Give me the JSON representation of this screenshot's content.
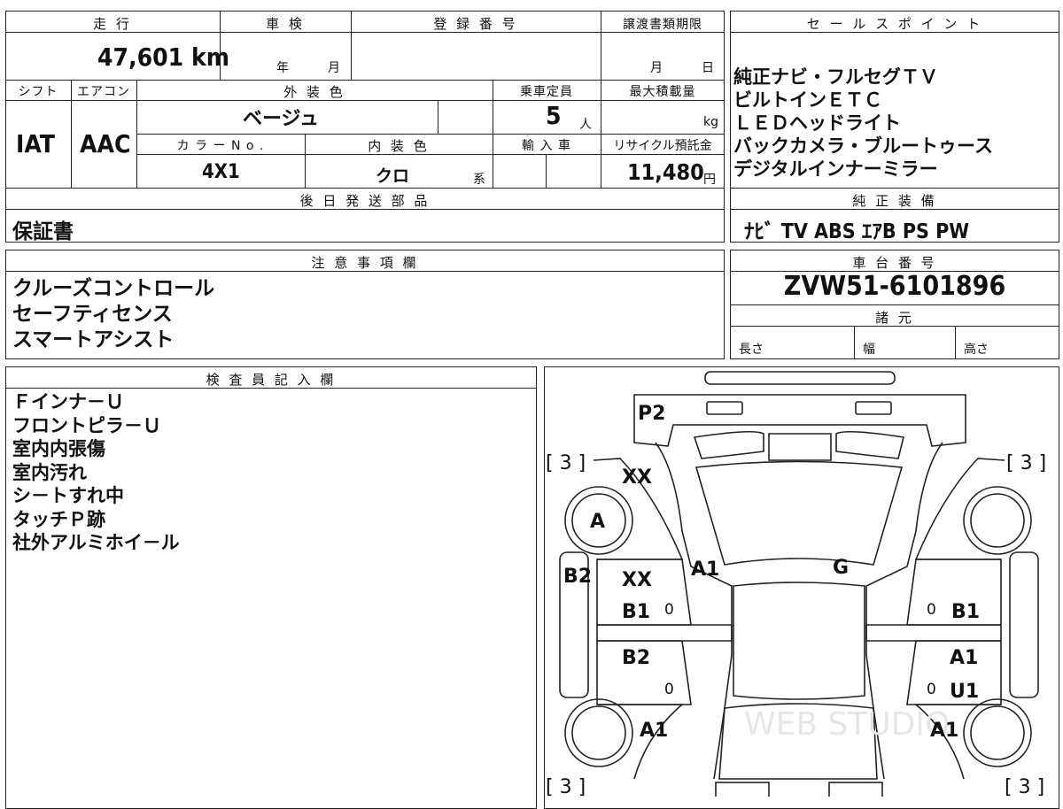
{
  "header": {
    "mileage_label": "走 行",
    "shaken_label": "車 検",
    "registration_label": "登 録 番 号",
    "transfer_deadline_label": "譲渡書類期限",
    "mileage_value": "47,601 km",
    "shaken_year": "年",
    "shaken_month": "月",
    "deadline_month": "月",
    "deadline_day": "日"
  },
  "row2": {
    "shift_label": "シフト",
    "aircon_label": "エアコン",
    "exterior_color_label": "外 装 色",
    "capacity_label": "乗車定員",
    "max_load_label": "最大積載量",
    "shift_value": "IAT",
    "aircon_value": "AAC",
    "exterior_color_value": "ベージュ",
    "capacity_value": "5",
    "capacity_unit": "人",
    "max_load_unit": "kg"
  },
  "row3": {
    "color_no_label": "カ ラ ー N o .",
    "interior_color_label": "内 装 色",
    "import_label": "輸 入 車",
    "recycle_label": "リサイクル預託金",
    "color_no_value": "4X1",
    "interior_color_value": "クロ",
    "interior_suffix": "系",
    "recycle_value": "11,480",
    "recycle_unit": "円"
  },
  "later_parts": {
    "label": "後 日 発 送 部 品",
    "value": "保証書"
  },
  "sales_points": {
    "label": "セ ー ル ス ポ イ ン ト",
    "items": [
      "純正ナビ・フルセグＴＶ",
      "ビルトインＥＴＣ",
      "ＬＥＤヘッドライト",
      "バックカメラ・ブルートゥース",
      "デジタルインナーミラー"
    ]
  },
  "genuine_equipment": {
    "label": "純 正 装 備",
    "value": "ﾅﾋﾞ TV ABS ｴｱB PS PW"
  },
  "notes": {
    "label": "注 意 事 項 欄",
    "items": [
      "クルーズコントロール",
      "セーフティセンス",
      "スマートアシスト"
    ]
  },
  "chassis": {
    "label": "車 台 番 号",
    "value": "ZVW51-6101896",
    "specs_label": "諸 元",
    "length_label": "長さ",
    "width_label": "幅",
    "height_label": "高さ"
  },
  "inspector": {
    "label": "検 査 員 記 入 欄",
    "items": [
      "Ｆインナ－Ｕ",
      "フロントピラ－Ｕ",
      "室内内張傷",
      "室内汚れ",
      "シ－トすれ中",
      "タッチＰ跡",
      "社外アルミホイ－ル"
    ]
  },
  "diagram": {
    "marks": {
      "p2": "P2",
      "tl_bracket": "[ 3 ]",
      "tr_bracket": "[ 3 ]",
      "bl_bracket": "[ 3 ]",
      "br_bracket": "[ 3 ]",
      "xx_top": "XX",
      "a_wheel": "A",
      "a1_center": "A1",
      "g": "G",
      "b2_side": "B2",
      "xx_door": "XX",
      "b1_left": "B1",
      "b1_right": "B1",
      "zero_1": "0",
      "zero_2": "0",
      "zero_3": "0",
      "zero_4": "0",
      "b2_left": "B2",
      "a1_right_door": "A1",
      "u1": "U1",
      "a1_bl": "A1",
      "a1_br": "A1"
    },
    "watermark": "WEB STUDIO"
  }
}
